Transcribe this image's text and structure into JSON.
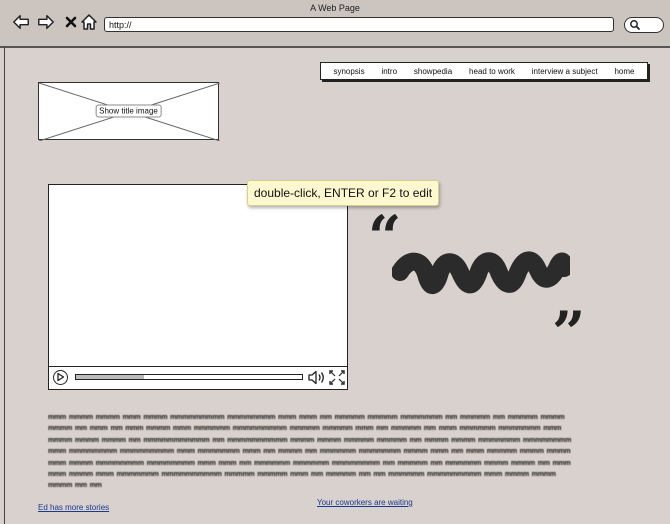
{
  "window": {
    "title": "A Web Page"
  },
  "browser": {
    "address": "http://",
    "icons": [
      "back-arrow-icon",
      "forward-arrow-icon",
      "close-icon",
      "home-icon",
      "search-icon"
    ]
  },
  "nav": {
    "items": [
      "synopsis",
      "intro",
      "showpedia",
      "head to work",
      "interview a subject",
      "home"
    ]
  },
  "title_image": {
    "label": "Show title image"
  },
  "tooltip": {
    "text": "double-click, ENTER or F2 to edit"
  },
  "video": {
    "progress": 0.3
  },
  "body_text": "mmm mmmm mmmm mmm mmmm mmmmmmmmm mmmmmmmm mmm mmm mm mmmmm mmmmm mmmmmmm mm mmmmm mm mmmmm mmmm mmmm mm mmm mm mmm mmmm mmm mmmmmm mmmmmmmmm mmmmm mmmmm mmm mm mmmmm mm mmm mmmmmm mmmmmmm mmm mmmm mmmm mmmm mm mmmmmmmmmmm mm mmmmmmmmmm mmmm mmmm mmmmm mmmmm mm mmmm mmmm mmmmmmm mmmmmmmm mmm mmmmmmmm mmmmmmmmm mmm mmmmmmm mmm mm mmmm mm mmmmmm mmmmmmm mmmm mmm mm mmm mmmmm mmmm mmmm mmm mmmm mmmmmmmm mmmmmmmm mmm mmm mm mmmmmm mmmmmm mmmmmmmm mm mmmmm mm mmmmmm mmmm mmmm mm mmm mmm mmmm mmm mmmmmmm mmmmmmmmmm mmmmm mmmmm mmm mm mmmmm mm mm mmmmmm mmmmmmmmm mmm mmmm mmmm mmmm mm mm",
  "links": {
    "left": "Ed has more stories",
    "center": "Your coworkers are waiting"
  }
}
